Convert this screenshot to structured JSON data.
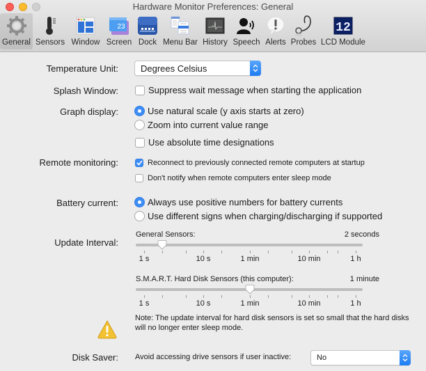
{
  "window": {
    "title": "Hardware Monitor Preferences: General"
  },
  "toolbar": {
    "items": [
      {
        "label": "General",
        "icon": "gear-icon",
        "active": true
      },
      {
        "label": "Sensors",
        "icon": "thermometer-icon",
        "active": false
      },
      {
        "label": "Window",
        "icon": "window-layout-icon",
        "active": false
      },
      {
        "label": "Screen",
        "icon": "screen-calendar-icon",
        "active": false
      },
      {
        "label": "Dock",
        "icon": "dock-icon",
        "active": false
      },
      {
        "label": "Menu Bar",
        "icon": "menu-bar-icon",
        "active": false
      },
      {
        "label": "History",
        "icon": "history-graph-icon",
        "active": false
      },
      {
        "label": "Speech",
        "icon": "speech-icon",
        "active": false
      },
      {
        "label": "Alerts",
        "icon": "alert-bubble-icon",
        "active": false
      },
      {
        "label": "Probes",
        "icon": "stethoscope-icon",
        "active": false
      },
      {
        "label": "LCD Module",
        "icon": "lcd-module-icon",
        "active": false
      }
    ],
    "lcd_text": "12",
    "screen_date": "23"
  },
  "general": {
    "temperature_unit": {
      "label": "Temperature Unit:",
      "value": "Degrees Celsius"
    },
    "splash_window": {
      "label": "Splash Window:",
      "option": "Suppress wait message when starting the application",
      "checked": false
    },
    "graph_display": {
      "label": "Graph display:",
      "radio_options": [
        {
          "label": "Use natural scale (y axis starts at zero)",
          "selected": true
        },
        {
          "label": "Zoom into current value range",
          "selected": false
        }
      ],
      "absolute_time": {
        "label": "Use absolute time designations",
        "checked": false
      }
    },
    "remote_monitoring": {
      "label": "Remote monitoring:",
      "options": [
        {
          "label": "Reconnect to previously connected remote computers at startup",
          "checked": true
        },
        {
          "label": "Don't notify when remote computers enter sleep mode",
          "checked": false
        }
      ]
    },
    "battery_current": {
      "label": "Battery current:",
      "radio_options": [
        {
          "label": "Always use positive numbers for battery currents",
          "selected": true
        },
        {
          "label": "Use different signs when charging/discharging if supported",
          "selected": false
        }
      ]
    },
    "update_interval": {
      "label": "Update Interval:",
      "tick_labels": [
        "1 s",
        "10 s",
        "1 min",
        "10 min",
        "1 h"
      ],
      "sliders": [
        {
          "label": "General Sensors:",
          "value_text": "2 seconds",
          "value_seconds": 2
        },
        {
          "label": "S.M.A.R.T. Hard Disk Sensors (this computer):",
          "value_text": "1 minute",
          "value_seconds": 60
        }
      ]
    },
    "note": "Note: The update interval for hard disk sensors is set so small that the hard disks will no longer enter sleep mode.",
    "disk_saver": {
      "label": "Disk Saver:",
      "option_label": "Avoid accessing drive sensors if user inactive:",
      "value": "No"
    }
  },
  "colors": {
    "accent": "#3d8df5",
    "background": "#ececec"
  }
}
